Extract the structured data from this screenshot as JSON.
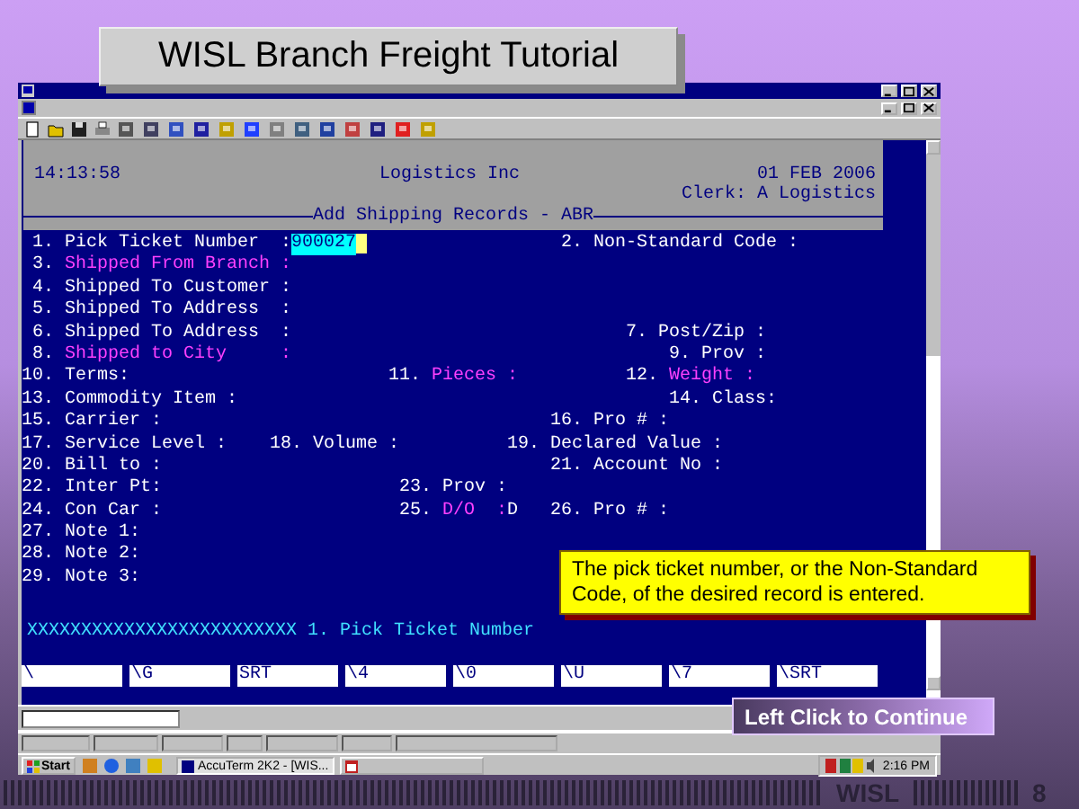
{
  "slide": {
    "title": "WISL Branch Freight Tutorial",
    "footer_label": "WISL",
    "page_number": "8"
  },
  "terminal": {
    "time": "14:13:58",
    "company": "Logistics Inc",
    "date": "01 FEB 2006",
    "clerk": "Clerk: A Logistics",
    "screen_title": "Add Shipping Records - ABR",
    "lines": [
      [
        {
          "number": "1.",
          "label": "Pick Ticket Number  :",
          "required": false,
          "value": "900027",
          "focused": true
        },
        {
          "number": "2.",
          "label": "Non-Standard Code :",
          "required": false
        }
      ],
      [
        {
          "number": "3.",
          "label": "Shipped From Branch :",
          "required": true
        }
      ],
      [
        {
          "number": "4.",
          "label": "Shipped To Customer :",
          "required": false
        }
      ],
      [
        {
          "number": "5.",
          "label": "Shipped To Address  :",
          "required": false
        }
      ],
      [
        {
          "number": "6.",
          "label": "Shipped To Address  :",
          "required": false
        },
        {
          "number": "7.",
          "label": "Post/Zip :",
          "required": false
        }
      ],
      [
        {
          "number": "8.",
          "label": "Shipped to City     :",
          "required": true
        },
        {
          "number": "9.",
          "label": "Prov :",
          "required": false
        }
      ],
      [
        {
          "number": "10.",
          "label": "Terms:",
          "required": false
        },
        {
          "number": "11.",
          "label": "Pieces :",
          "required": true
        },
        {
          "number": "12.",
          "label": "Weight :",
          "required": true
        }
      ],
      [
        {
          "number": "13.",
          "label": "Commodity Item :",
          "required": false
        },
        {
          "number": "14.",
          "label": "Class:",
          "required": false
        }
      ],
      [
        {
          "number": "15.",
          "label": "Carrier :",
          "required": false
        },
        {
          "number": "16.",
          "label": "Pro # :",
          "required": false
        }
      ],
      [
        {
          "number": "17.",
          "label": "Service Level :",
          "required": false
        },
        {
          "number": "18.",
          "label": "Volume :",
          "required": false
        },
        {
          "number": "19.",
          "label": "Declared Value :",
          "required": false
        }
      ],
      [
        {
          "number": "20.",
          "label": "Bill to :",
          "required": false
        },
        {
          "number": "21.",
          "label": "Account No :",
          "required": false
        }
      ],
      [
        {
          "number": "22.",
          "label": "Inter Pt:",
          "required": false
        },
        {
          "number": "23.",
          "label": "Prov :",
          "required": false
        }
      ],
      [
        {
          "number": "24.",
          "label": "Con Car :",
          "required": false
        },
        {
          "number": "25.",
          "label": "D/O  :",
          "required": true,
          "value": "D",
          "focused": false
        },
        {
          "number": "26.",
          "label": "Pro # :",
          "required": false
        }
      ],
      [
        {
          "number": "27.",
          "label": "Note 1:",
          "required": false
        }
      ],
      [
        {
          "number": "28.",
          "label": "Note 2:",
          "required": false
        }
      ],
      [
        {
          "number": "29.",
          "label": "Note 3:",
          "required": false
        }
      ]
    ],
    "prompt": "XXXXXXXXXXXXXXXXXXXXXXXXX 1. Pick Ticket Number",
    "function_keys": [
      "\\",
      "\\G",
      "SRT",
      "\\4",
      "\\0",
      "\\U",
      "\\7",
      "\\SRT"
    ]
  },
  "taskbar": {
    "start": "Start",
    "buttons": [
      {
        "label": "AccuTerm 2K2 - [WIS...",
        "selected": true
      }
    ],
    "clock": "2:16 PM"
  },
  "callout": {
    "text": "The pick ticket number, or the Non-Standard Code, of the desired record is entered."
  },
  "continue_button": {
    "label": "Left Click to Continue"
  }
}
